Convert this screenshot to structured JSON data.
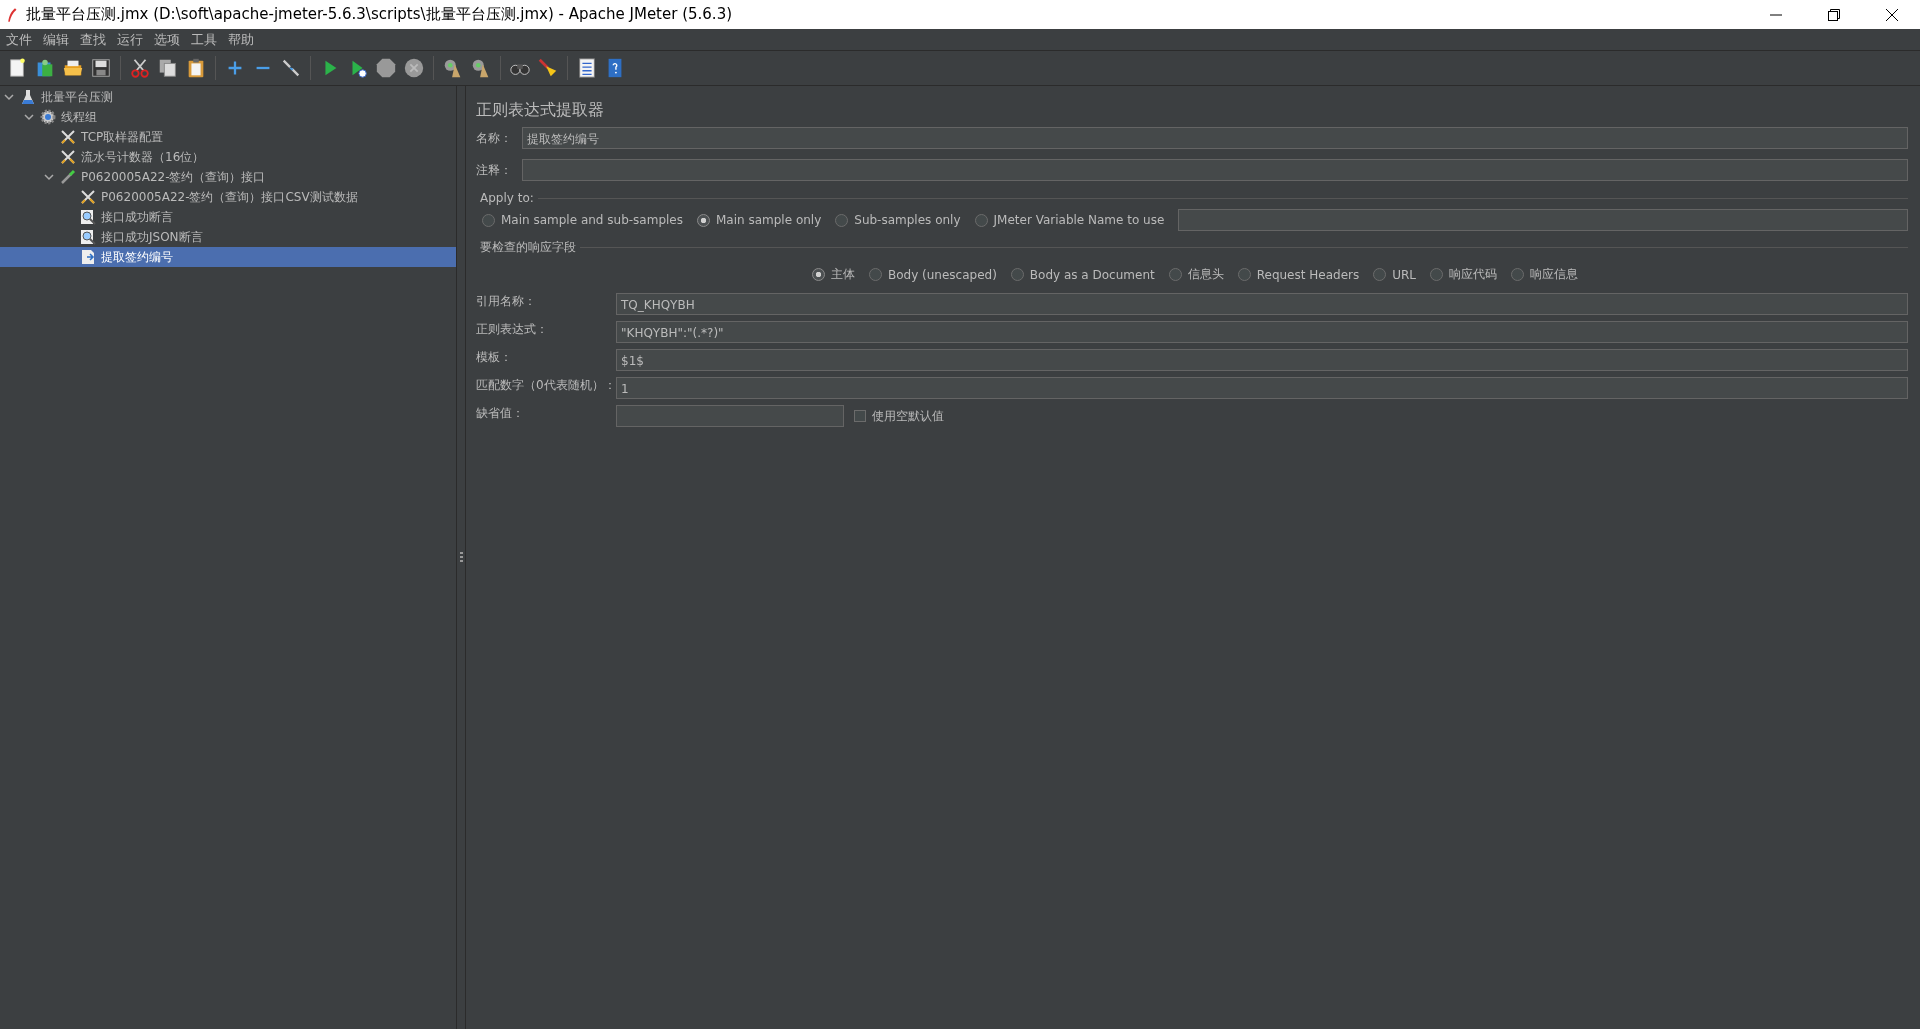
{
  "window": {
    "title": "批量平台压测.jmx (D:\\soft\\apache-jmeter-5.6.3\\scripts\\批量平台压测.jmx) - Apache JMeter (5.6.3)"
  },
  "menu": [
    "文件",
    "编辑",
    "查找",
    "运行",
    "选项",
    "工具",
    "帮助"
  ],
  "tree": [
    {
      "label": "批量平台压测",
      "kind": "plan",
      "expanded": true,
      "selected": false,
      "children": [
        {
          "label": "线程组",
          "kind": "threads",
          "expanded": true,
          "selected": false,
          "children": [
            {
              "label": "TCP取样器配置",
              "kind": "config",
              "selected": false
            },
            {
              "label": "流水号计数器（16位）",
              "kind": "config",
              "selected": false
            },
            {
              "label": "P0620005A22-签约（查询）接口",
              "kind": "sampler",
              "expanded": true,
              "selected": false,
              "children": [
                {
                  "label": "P0620005A22-签约（查询）接口CSV测试数据",
                  "kind": "config",
                  "selected": false
                },
                {
                  "label": "接口成功断言",
                  "kind": "assertion",
                  "selected": false
                },
                {
                  "label": "接口成功JSON断言",
                  "kind": "assertion",
                  "selected": false
                },
                {
                  "label": "提取签约编号",
                  "kind": "extractor",
                  "selected": true
                }
              ]
            }
          ]
        }
      ]
    }
  ],
  "panel": {
    "title": "正则表达式提取器",
    "name": {
      "label": "名称：",
      "value": "提取签约编号"
    },
    "comment": {
      "label": "注释："
    },
    "apply_to": {
      "legend": "Apply to:",
      "options": [
        {
          "label": "Main sample and sub-samples",
          "selected": false
        },
        {
          "label": "Main sample only",
          "selected": true
        },
        {
          "label": "Sub-samples only",
          "selected": false
        },
        {
          "label": "JMeter Variable Name to use",
          "selected": false
        }
      ]
    },
    "field_to_check": {
      "legend": "要检查的响应字段",
      "options": [
        {
          "label": "主体",
          "selected": true
        },
        {
          "label": "Body (unescaped)",
          "selected": false
        },
        {
          "label": "Body as a Document",
          "selected": false
        },
        {
          "label": "信息头",
          "selected": false
        },
        {
          "label": "Request Headers",
          "selected": false
        },
        {
          "label": "URL",
          "selected": false
        },
        {
          "label": "响应代码",
          "selected": false
        },
        {
          "label": "响应信息",
          "selected": false
        }
      ]
    },
    "fields": [
      {
        "label": "引用名称：",
        "value": "TQ_KHQYBH"
      },
      {
        "label": "正则表达式：",
        "value": "\"KHQYBH\":\"(.*?)\""
      },
      {
        "label": "模板：",
        "value": "$1$"
      },
      {
        "label": "匹配数字（0代表随机）：",
        "value": "1"
      }
    ],
    "default": {
      "label": "缺省值：",
      "checkbox": {
        "label": "使用空默认值",
        "checked": false
      }
    }
  }
}
